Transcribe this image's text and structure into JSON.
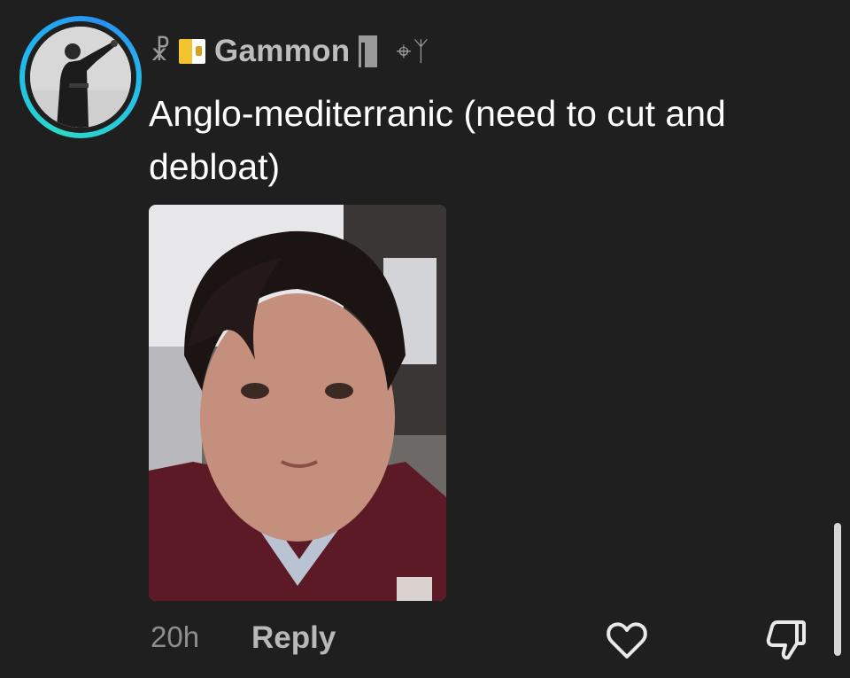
{
  "comment": {
    "author": {
      "avatar_icon": "avatar-photo",
      "ring_colors": [
        "#2bd9c7",
        "#2a8ff2"
      ],
      "prefix_symbol": "☧",
      "flag_icon": "vatican-flag-icon",
      "username": "Gammon",
      "axe_icon": "axe-icon",
      "suffix_symbols": "⌖ᛉ"
    },
    "text": "Anglo-mediterranic (need to cut and debloat)",
    "attachment": {
      "type": "photo"
    },
    "meta": {
      "timestamp": "20h",
      "reply_label": "Reply",
      "like_icon": "heart-outline-icon",
      "dislike_icon": "thumbs-down-outline-icon"
    }
  },
  "colors": {
    "background": "#1f1f1f",
    "text": "#ffffff",
    "muted": "#8e8e8e"
  }
}
